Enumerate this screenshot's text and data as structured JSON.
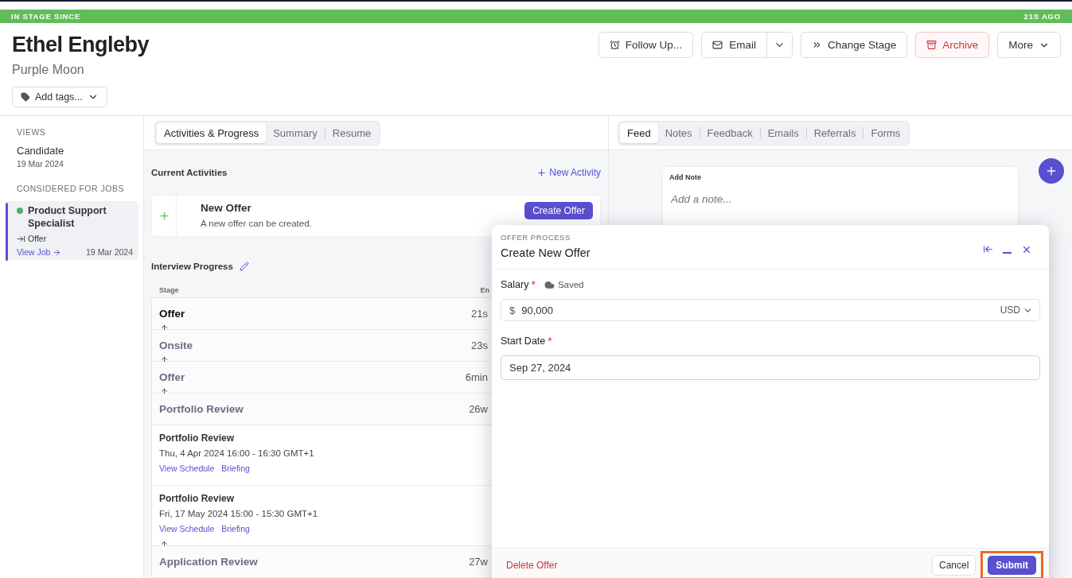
{
  "stage_bar": {
    "label": "IN STAGE SINCE",
    "time": "21S AGO"
  },
  "candidate": {
    "name": "Ethel Engleby",
    "company": "Purple Moon",
    "tags_button": "Add tags..."
  },
  "actions": [
    {
      "label": "Follow Up...",
      "kind": "plain"
    },
    {
      "label": "Email",
      "kind": "split"
    },
    {
      "label": "Change Stage",
      "kind": "plain"
    },
    {
      "label": "Archive",
      "kind": "danger"
    },
    {
      "label": "More",
      "kind": "menu"
    }
  ],
  "sidebar": {
    "views_heading": "VIEWS",
    "views": [
      {
        "title": "Candidate",
        "date": "19 Mar 2024"
      }
    ],
    "jobs_heading": "CONSIDERED FOR JOBS",
    "jobs": [
      {
        "title": "Product Support Specialist",
        "stage": "Offer",
        "link": "View Job",
        "date": "19 Mar 2024",
        "color": "#4caf6e",
        "selected": true
      }
    ]
  },
  "main_tabs": [
    {
      "label": "Activities & Progress",
      "selected": true
    },
    {
      "label": "Summary",
      "selected": false
    },
    {
      "label": "Resume",
      "selected": false
    }
  ],
  "current_activities": {
    "heading": "Current Activities",
    "new_link": "New Activity",
    "activity": {
      "title": "New Offer",
      "description": "A new offer can be created.",
      "button": "Create Offer"
    }
  },
  "interview_progress": {
    "heading": "Interview Progress",
    "columns": [
      "Stage",
      "En"
    ],
    "rows": [
      {
        "kind": "stage",
        "title": "Offer",
        "time": "21s",
        "current": true
      },
      {
        "kind": "stage",
        "title": "Onsite",
        "time": "23s",
        "current": false
      },
      {
        "kind": "stage",
        "title": "Offer",
        "time": "6min",
        "current": false
      },
      {
        "kind": "stage",
        "title": "Portfolio Review",
        "time": "26w",
        "current": false
      },
      {
        "kind": "event",
        "title": "Portfolio Review",
        "when": "Thu, 4 Apr 2024 16:00 - 16:30 GMT+1",
        "links": [
          "View Schedule",
          "Briefing"
        ]
      },
      {
        "kind": "event",
        "title": "Portfolio Review",
        "when": "Fri, 17 May 2024 15:00 - 15:30 GMT+1",
        "links": [
          "View Schedule",
          "Briefing"
        ]
      },
      {
        "kind": "stage",
        "title": "Application Review",
        "time": "27w",
        "current": false
      }
    ]
  },
  "feed_tabs": [
    {
      "label": "Feed",
      "selected": true
    },
    {
      "label": "Notes",
      "selected": false
    },
    {
      "label": "Feedback",
      "selected": false
    },
    {
      "label": "Emails",
      "selected": false
    },
    {
      "label": "Referrals",
      "selected": false
    },
    {
      "label": "Forms",
      "selected": false
    }
  ],
  "add_note": {
    "label": "Add Note",
    "placeholder": "Add a note..."
  },
  "dialog": {
    "eyebrow": "OFFER PROCESS",
    "title": "Create New Offer",
    "salary": {
      "label": "Salary",
      "required_mark": "*",
      "status": "Saved",
      "currency_symbol": "$",
      "value": "90,000",
      "currency": "USD"
    },
    "start_date": {
      "label": "Start Date",
      "required_mark": "*",
      "value": "Sep 27, 2024"
    },
    "delete": "Delete Offer",
    "cancel": "Cancel",
    "submit": "Submit",
    "submit_highlighted": true
  }
}
